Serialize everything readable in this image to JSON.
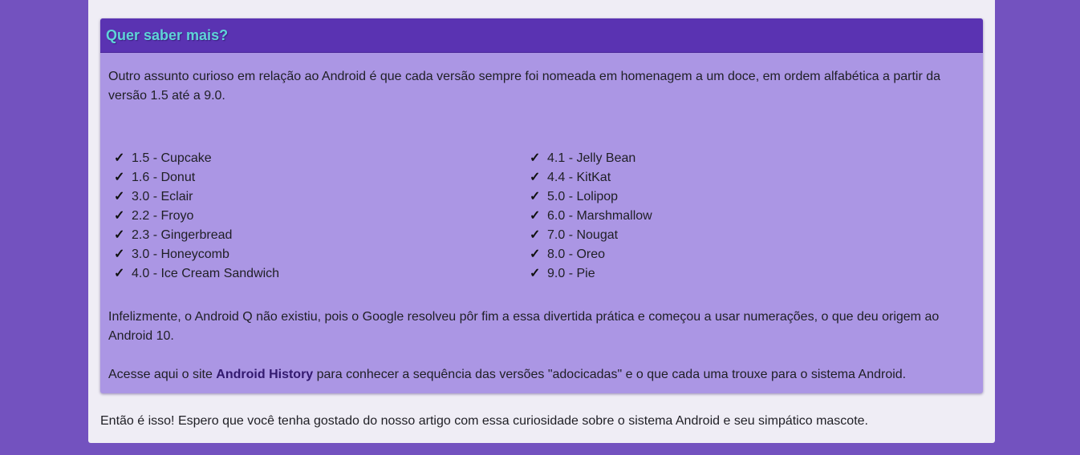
{
  "card": {
    "title": "Quer saber mais?",
    "intro": "Outro assunto curioso em relação ao Android é que cada versão sempre foi nomeada em homenagem a um doce, em ordem alfabética a partir da versão 1.5 até a 9.0.",
    "check_glyph": "✓",
    "versions_left": [
      "1.5 - Cupcake",
      "1.6 - Donut",
      "3.0 - Eclair",
      "2.2 - Froyo",
      "2.3 - Gingerbread",
      "3.0 - Honeycomb",
      "4.0 - Ice Cream Sandwich"
    ],
    "versions_right": [
      "4.1 - Jelly Bean",
      "4.4 - KitKat",
      "5.0 - Lolipop",
      "6.0 - Marshmallow",
      "7.0 - Nougat",
      "8.0 - Oreo",
      "9.0 - Pie"
    ],
    "android_q_text": "Infelizmente, o Android Q não existiu, pois o Google resolveu pôr fim a essa divertida prática e começou a usar numerações, o que deu origem ao Android 10.",
    "access_before": "Acesse aqui o site ",
    "access_link": "Android History",
    "access_after": " para conhecer a sequência das versões \"adocicadas\" e o que cada uma trouxe para o sistema Android."
  },
  "closing": "Então é isso! Espero que você tenha gostado do nosso artigo com essa curiosidade sobre o sistema Android e seu simpático mascote.",
  "colors": {
    "page_background": "#7352bf",
    "content_background": "#efedf5",
    "card_background": "#ab96e4",
    "card_header": "#5a33b2",
    "title_color": "#5fd4d8",
    "link_color": "#32196e"
  }
}
